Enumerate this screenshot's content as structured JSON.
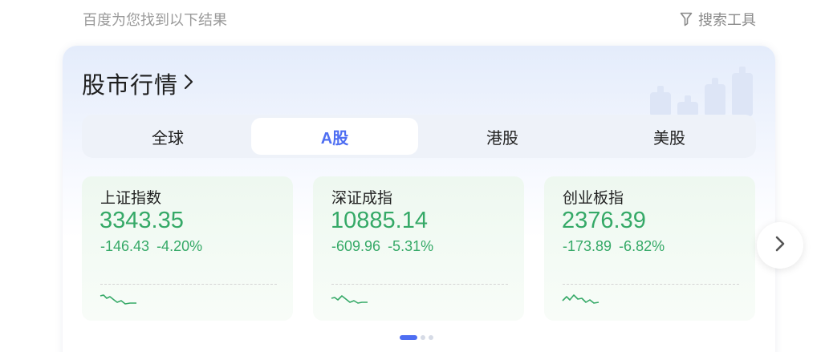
{
  "header": {
    "result_hint": "百度为您找到以下结果",
    "search_tools_label": "搜索工具"
  },
  "card": {
    "title": "股市行情",
    "tabs": [
      {
        "label": "全球",
        "active": false
      },
      {
        "label": "A股",
        "active": true
      },
      {
        "label": "港股",
        "active": false
      },
      {
        "label": "美股",
        "active": false
      }
    ],
    "indices": [
      {
        "name": "上证指数",
        "price": "3343.35",
        "change": "-146.43",
        "change_pct": "-4.20%"
      },
      {
        "name": "深证成指",
        "price": "10885.14",
        "change": "-609.96",
        "change_pct": "-5.31%"
      },
      {
        "name": "创业板指",
        "price": "2376.39",
        "change": "-173.89",
        "change_pct": "-6.82%"
      }
    ],
    "carousel": {
      "page_count": 3,
      "active_page": 1
    }
  },
  "colors": {
    "accent": "#4e6ef2",
    "down": "#35a967"
  },
  "icons": {
    "filter": "filter-icon",
    "title_arrow": "chevron-right-icon",
    "next": "chevron-right-icon",
    "decor": "bar-chart-decoration"
  }
}
